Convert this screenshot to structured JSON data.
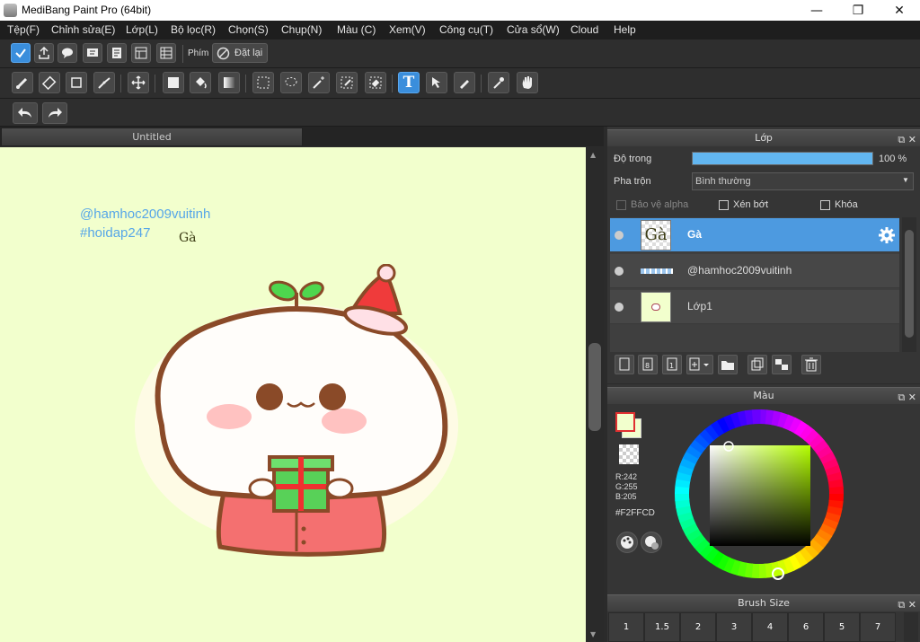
{
  "window": {
    "title": "MediBang Paint Pro (64bit)",
    "controls": [
      "—",
      "❐",
      "✕"
    ]
  },
  "menu": [
    "Tệp(F)",
    "Chỉnh sửa(E)",
    "Lớp(L)",
    "Bộ lọc(R)",
    "Chọn(S)",
    "Chụp(N)",
    "Màu (C)",
    "Xem(V)",
    "Công cụ(T)",
    "Cửa sổ(W)",
    "Cloud",
    "Help"
  ],
  "toolbar1": {
    "key_label": "Phím",
    "reset_label": "Đặt lại"
  },
  "canvas_tab": {
    "label": "Untitled"
  },
  "canvas": {
    "text_handle": "@hamhoc2009vuitinh",
    "text_tag": "#hoidap247",
    "text_ga": "Gà",
    "bg": "#f2ffcd"
  },
  "layer_panel": {
    "title": "Lớp",
    "opacity_label": "Độ trong",
    "opacity_value": "100 %",
    "opacity_fraction": 1.0,
    "blend_label": "Pha trộn",
    "blend_value": "Bình thường",
    "protect_alpha": "Bảo vệ alpha",
    "clip": "Xén bớt",
    "lock": "Khóa",
    "layers": [
      {
        "name": "Gà",
        "thumb": "Gà",
        "selected": true
      },
      {
        "name": "@hamhoc2009vuitinh",
        "thumb": "",
        "selected": false
      },
      {
        "name": "Lớp1",
        "thumb": "",
        "selected": false
      }
    ]
  },
  "color_panel": {
    "title": "Màu",
    "r": "R:242",
    "g": "G:255",
    "b": "B:205",
    "hex": "#F2FFCD",
    "fg": "#f2ffcd",
    "accent": "#3a8edc"
  },
  "brush_panel": {
    "title": "Brush Size",
    "sizes": [
      "1",
      "1.5",
      "2",
      "3",
      "4",
      "6",
      "5",
      "7"
    ]
  }
}
